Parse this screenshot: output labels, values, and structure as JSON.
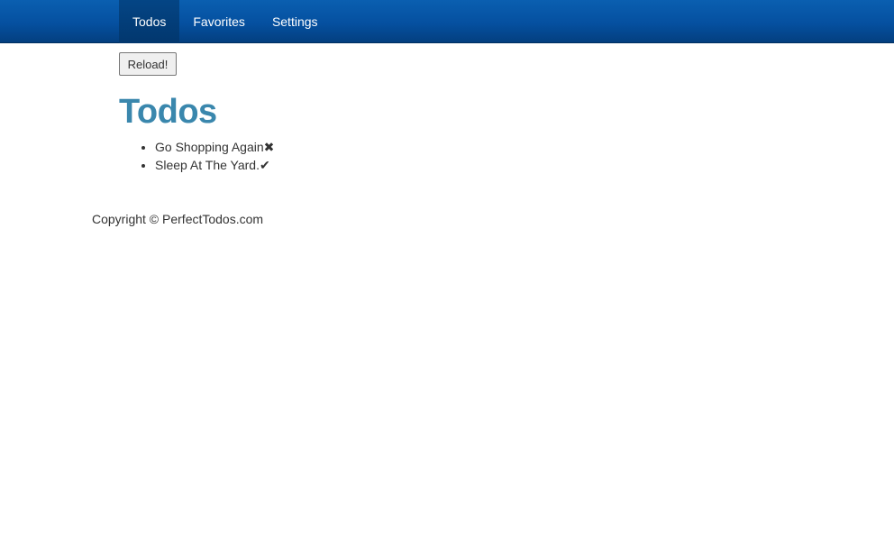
{
  "nav": {
    "items": [
      {
        "label": "Todos",
        "active": true
      },
      {
        "label": "Favorites",
        "active": false
      },
      {
        "label": "Settings",
        "active": false
      }
    ]
  },
  "toolbar": {
    "reload_label": "Reload!"
  },
  "main": {
    "title": "Todos",
    "todos": [
      {
        "text": "Go Shopping Again",
        "status_icon": "✖",
        "icon_name": "cross-icon"
      },
      {
        "text": "Sleep At The Yard.",
        "status_icon": "✔",
        "icon_name": "check-icon"
      }
    ]
  },
  "footer": {
    "copyright": "Copyright © PerfectTodos.com"
  },
  "colors": {
    "navbar": "#0550a0",
    "nav_active": "#043c78",
    "title": "#3a87ad",
    "text": "#333333"
  }
}
